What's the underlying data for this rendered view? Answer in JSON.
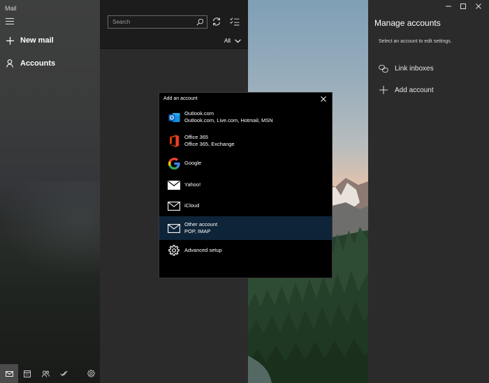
{
  "app": {
    "title": "Mail"
  },
  "nav": {
    "new_mail": "New mail",
    "accounts": "Accounts"
  },
  "list_pane": {
    "search_placeholder": "Search",
    "filter": "All"
  },
  "manage_accounts": {
    "title": "Manage accounts",
    "subtitle": "Select an account to edit settings.",
    "link_inboxes": "Link inboxes",
    "add_account": "Add account"
  },
  "dialog": {
    "title": "Add an account",
    "accounts": [
      {
        "name": "Outlook.com",
        "detail": "Outlook.com, Live.com, Hotmail, MSN",
        "icon": "outlook-icon"
      },
      {
        "name": "Office 365",
        "detail": "Office 365, Exchange",
        "icon": "office-icon"
      },
      {
        "name": "Google",
        "detail": "",
        "icon": "google-icon"
      },
      {
        "name": "Yahoo!",
        "detail": "",
        "icon": "envelope-icon"
      },
      {
        "name": "iCloud",
        "detail": "",
        "icon": "envelope-icon"
      },
      {
        "name": "Other account",
        "detail": "POP, IMAP",
        "icon": "envelope-icon"
      },
      {
        "name": "Advanced setup",
        "detail": "",
        "icon": "gear-icon"
      }
    ]
  },
  "colors": {
    "selected_row": "#0e2438",
    "outlook_blue": "#0a64c2",
    "office_red": "#d83b01"
  }
}
